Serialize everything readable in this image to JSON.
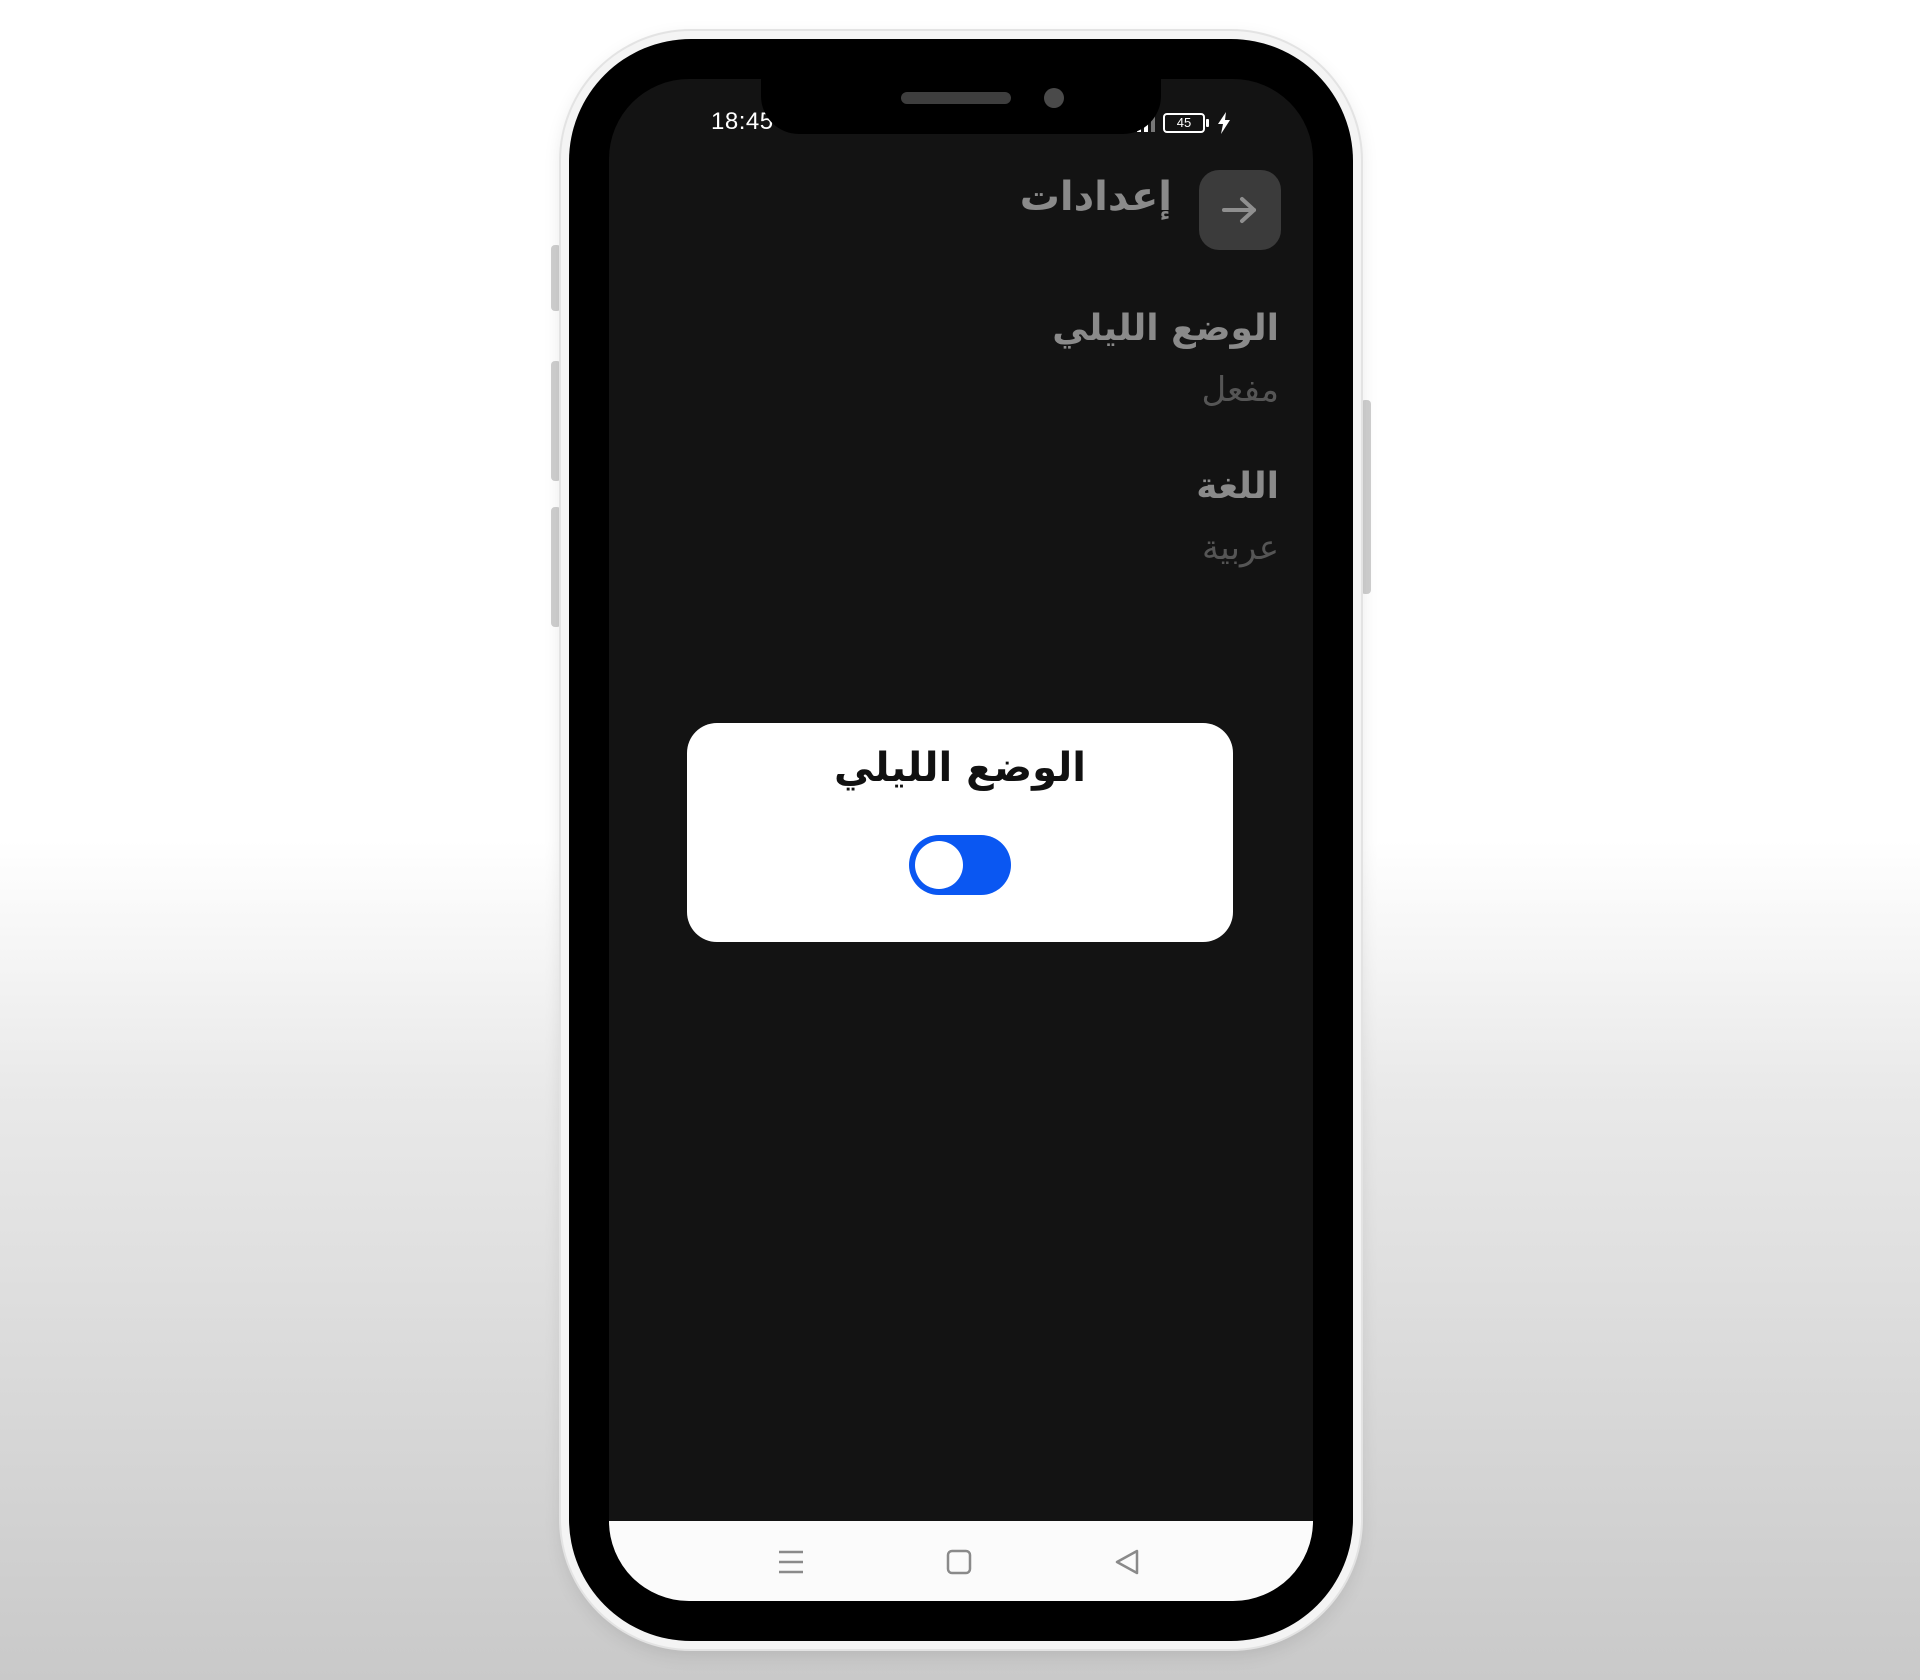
{
  "status_bar": {
    "time": "18:45",
    "battery": "45"
  },
  "header": {
    "title": "إعدادات",
    "back_icon": "arrow-right-icon"
  },
  "settings": [
    {
      "title": "الوضع الليلي",
      "value": "مفعل"
    },
    {
      "title": "اللغة",
      "value": "عربية"
    }
  ],
  "dialog": {
    "title": "الوضع الليلي",
    "toggle_on": true,
    "toggle_color": "#0a57f2"
  },
  "nav_bar": {
    "icons": [
      "menu-icon",
      "home-icon",
      "back-icon"
    ]
  }
}
